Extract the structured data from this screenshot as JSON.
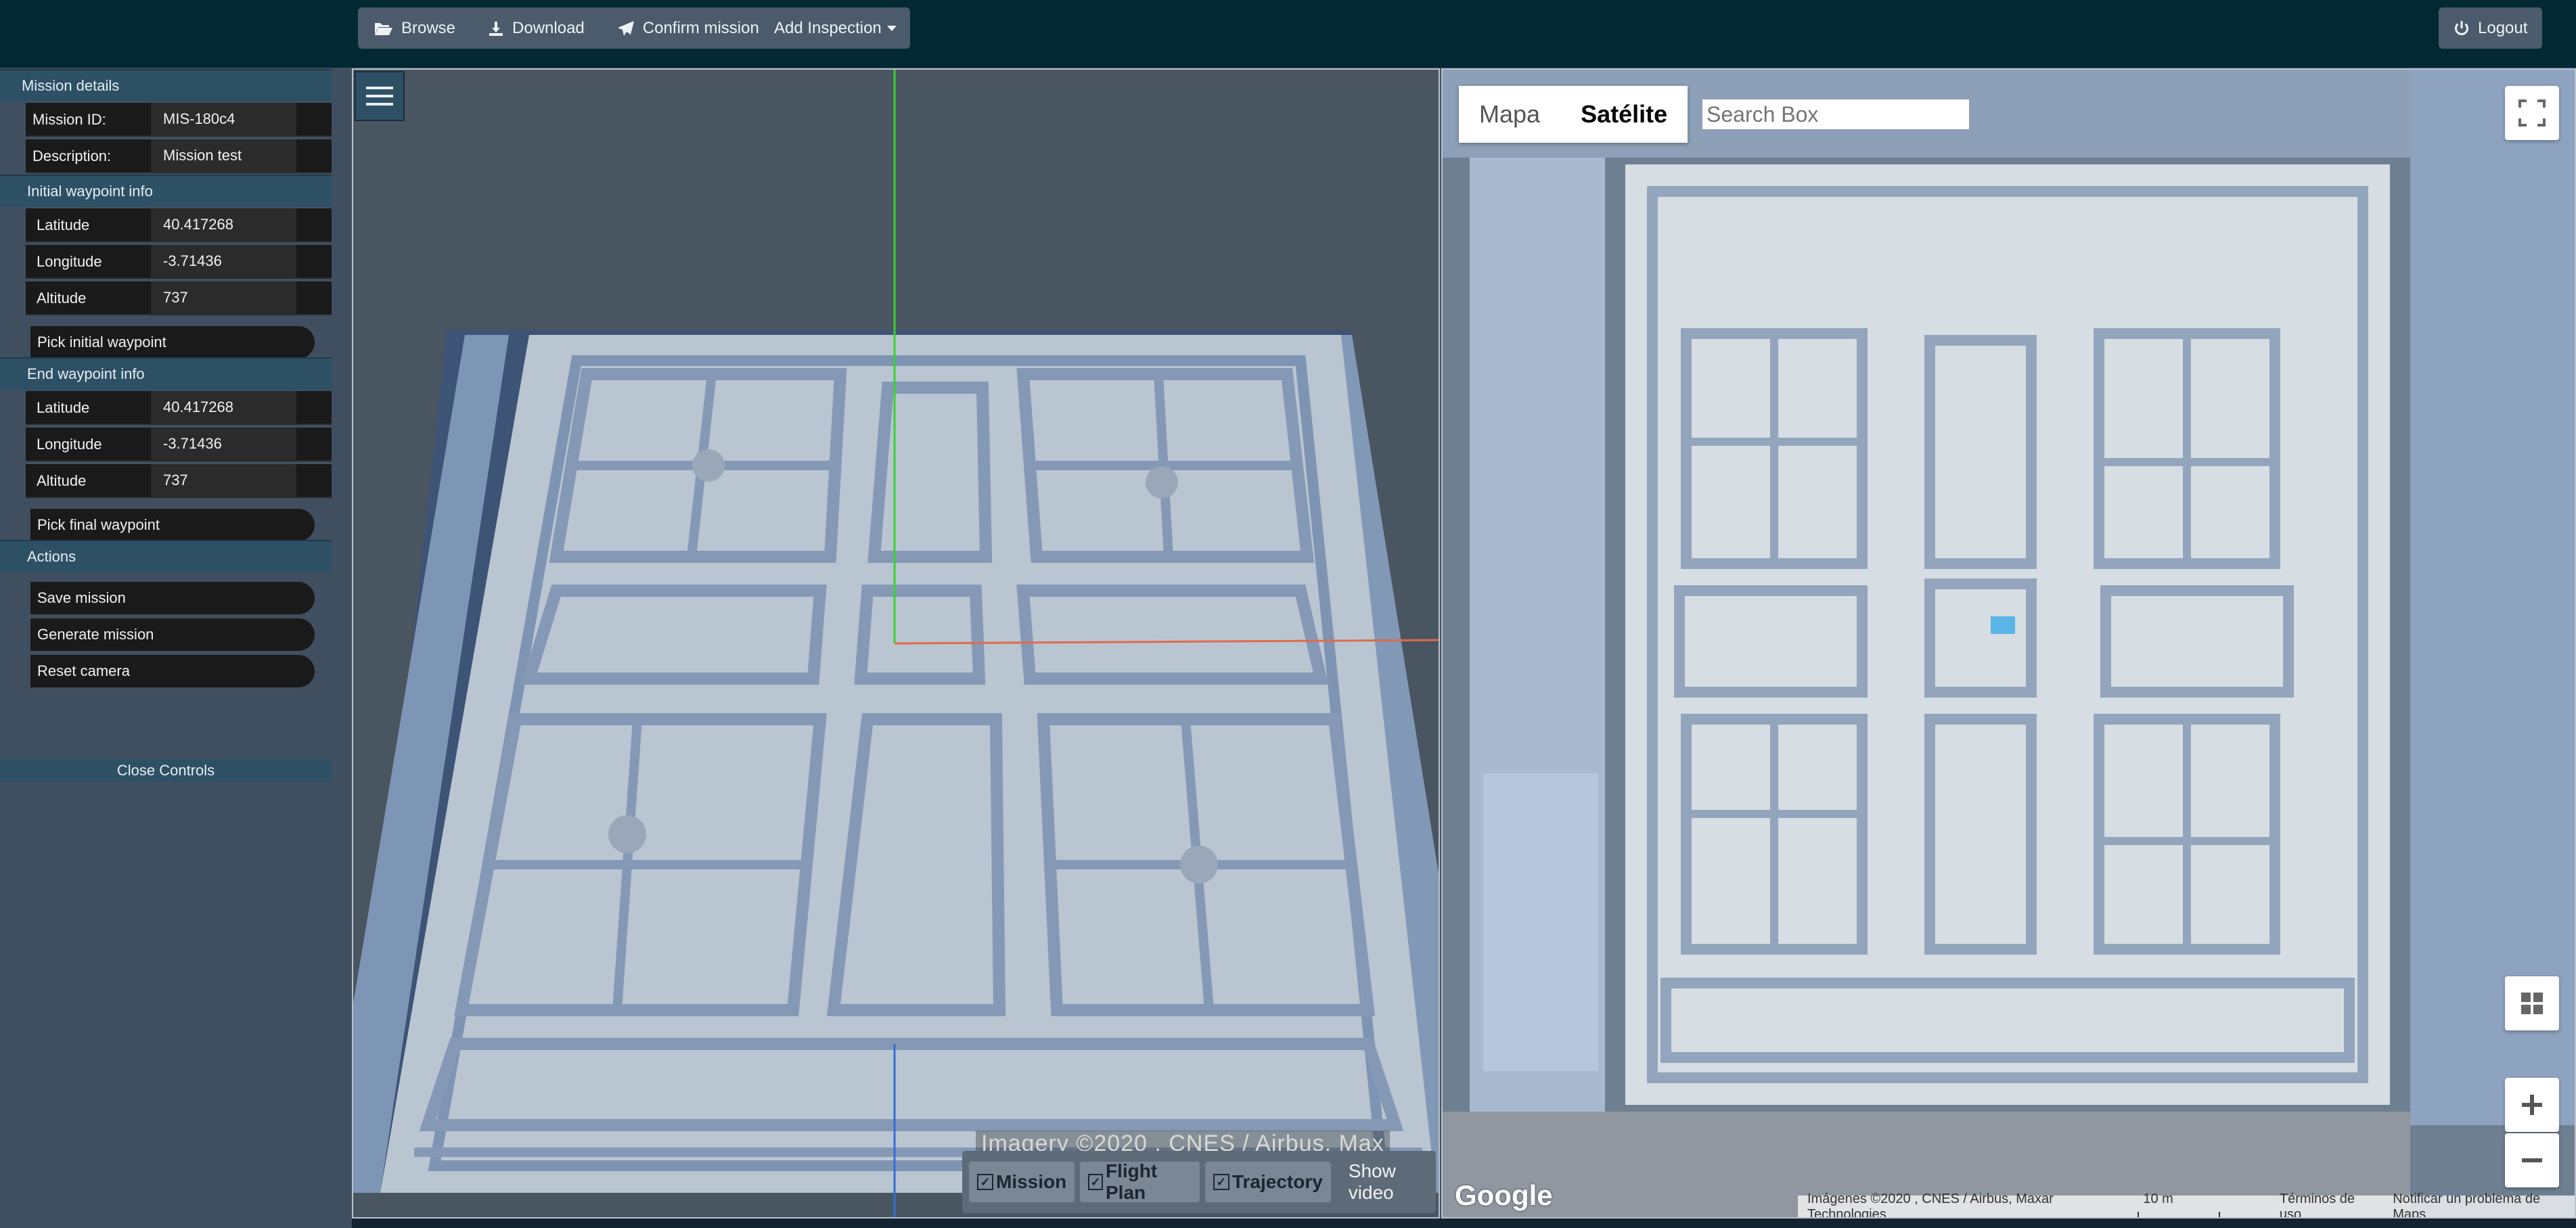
{
  "toolbar": {
    "browse": "Browse",
    "download": "Download",
    "confirm_mission": "Confirm mission",
    "add_inspection": "Add Inspection",
    "logout": "Logout"
  },
  "panel": {
    "mission_details_header": "Mission details",
    "mission_id_label": "Mission ID:",
    "mission_id_value": "MIS-180c4",
    "description_label": "Description:",
    "description_value": "Mission test",
    "initial_header": "Initial waypoint info",
    "initial": {
      "lat_label": "Latitude",
      "lat": "40.417268",
      "lon_label": "Longitude",
      "lon": "-3.71436",
      "alt_label": "Altitude",
      "alt": "737"
    },
    "pick_initial": "Pick initial waypoint",
    "end_header": "End waypoint info",
    "end": {
      "lat_label": "Latitude",
      "lat": "40.417268",
      "lon_label": "Longitude",
      "lon": "-3.71436",
      "alt_label": "Altitude",
      "alt": "737"
    },
    "pick_final": "Pick final waypoint",
    "actions_header": "Actions",
    "save_mission": "Save mission",
    "generate_mission": "Generate mission",
    "reset_camera": "Reset camera",
    "close_controls": "Close Controls"
  },
  "view3d": {
    "imagery_credit": "Imagery ©2020 , CNES / Airbus, Max",
    "toggles": {
      "mission": "Mission",
      "flight_plan": "Flight Plan",
      "trajectory": "Trajectory"
    },
    "show_video": "Show video"
  },
  "map": {
    "type_map": "Mapa",
    "type_satellite": "Satélite",
    "search_placeholder": "Search Box",
    "google": "Google",
    "footer": {
      "imagery": "Imágenes ©2020 , CNES / Airbus, Maxar Technologies",
      "scale": "10 m",
      "terms": "Términos de uso",
      "report": "Notificar un problema de Maps"
    }
  },
  "colors": {
    "toolbar_bg": "#022833",
    "panel_bg": "#3f4f5f",
    "header_bg": "#2e5065",
    "row_bg": "#1a1a1a"
  }
}
